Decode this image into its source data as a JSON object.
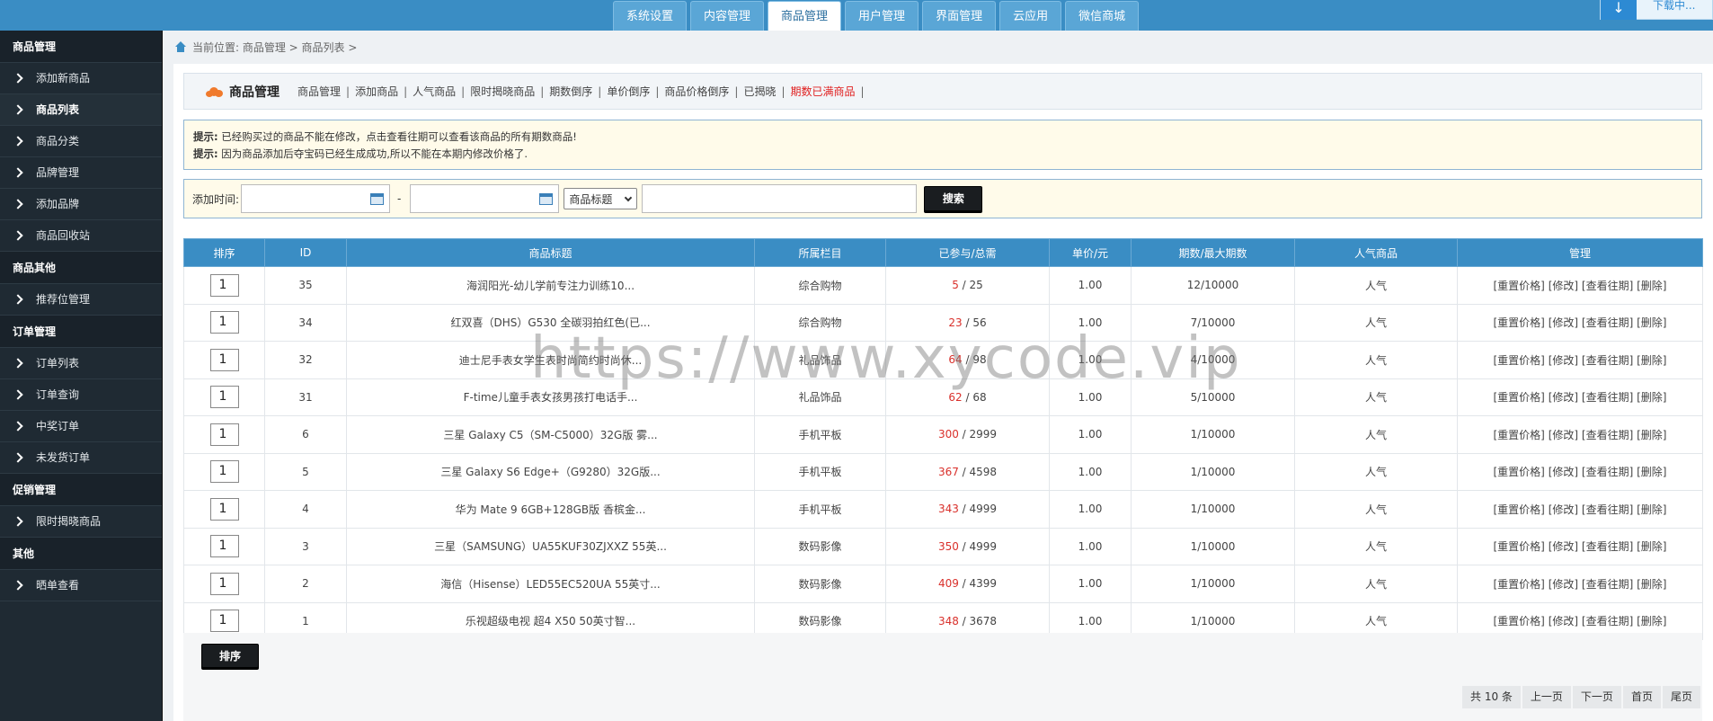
{
  "topnav": {
    "tabs": [
      {
        "label": "系统设置"
      },
      {
        "label": "内容管理"
      },
      {
        "label": "商品管理",
        "active": true
      },
      {
        "label": "用户管理"
      },
      {
        "label": "界面管理"
      },
      {
        "label": "云应用"
      },
      {
        "label": "微信商城"
      }
    ],
    "download_label": "下载中..."
  },
  "sidebar": {
    "sections": [
      {
        "title": "商品管理",
        "items": [
          {
            "label": "添加新商品"
          },
          {
            "label": "商品列表",
            "active": true
          },
          {
            "label": "商品分类"
          },
          {
            "label": "品牌管理"
          },
          {
            "label": "添加品牌"
          },
          {
            "label": "商品回收站"
          }
        ]
      },
      {
        "title": "商品其他",
        "items": [
          {
            "label": "推荐位管理"
          }
        ]
      },
      {
        "title": "订单管理",
        "items": [
          {
            "label": "订单列表"
          },
          {
            "label": "订单查询"
          },
          {
            "label": "中奖订单"
          },
          {
            "label": "未发货订单"
          }
        ]
      },
      {
        "title": "促销管理",
        "items": [
          {
            "label": "限时揭晓商品"
          }
        ]
      },
      {
        "title": "其他",
        "items": [
          {
            "label": "晒单查看"
          }
        ]
      }
    ]
  },
  "breadcrumb": {
    "text": "当前位置: 商品管理 > 商品列表 >"
  },
  "subnav": {
    "title": "商品管理",
    "links": [
      {
        "label": "商品管理"
      },
      {
        "label": "添加商品"
      },
      {
        "label": "人气商品"
      },
      {
        "label": "限时揭晓商品"
      },
      {
        "label": "期数倒序"
      },
      {
        "label": "单价倒序"
      },
      {
        "label": "商品价格倒序"
      },
      {
        "label": "已揭晓"
      },
      {
        "label": "期数已满商品",
        "highlight": true
      }
    ]
  },
  "tips": {
    "label": "提示:",
    "line1": "已经购买过的商品不能在修改，点击查看往期可以查看该商品的所有期数商品!",
    "line2": "因为商品添加后夺宝码已经生成成功,所以不能在本期内修改价格了."
  },
  "search": {
    "date_label": "添加时间:",
    "date_from": "",
    "date_to": "",
    "separator": "-",
    "field_select": "商品标题",
    "keyword": "",
    "button": "搜索"
  },
  "table": {
    "headers": [
      "排序",
      "ID",
      "商品标题",
      "所属栏目",
      "已参与/总需",
      "单价/元",
      "期数/最大期数",
      "人气商品",
      "管理"
    ],
    "rows": [
      {
        "sort": "1",
        "id": "35",
        "title": "海润阳光-幼儿学前专注力训练10...",
        "category": "综合购物",
        "joined": "5",
        "total": "25",
        "price": "1.00",
        "period": "12/10000",
        "hot": "人气"
      },
      {
        "sort": "1",
        "id": "34",
        "title": "红双喜（DHS）G530 全碳羽拍红色(已...",
        "category": "综合购物",
        "joined": "23",
        "total": "56",
        "price": "1.00",
        "period": "7/10000",
        "hot": "人气"
      },
      {
        "sort": "1",
        "id": "32",
        "title": "迪士尼手表女学生表时尚简约时尚休...",
        "category": "礼品饰品",
        "joined": "64",
        "total": "98",
        "price": "1.00",
        "period": "4/10000",
        "hot": "人气"
      },
      {
        "sort": "1",
        "id": "31",
        "title": "F-time儿童手表女孩男孩打电话手...",
        "category": "礼品饰品",
        "joined": "62",
        "total": "68",
        "price": "1.00",
        "period": "5/10000",
        "hot": "人气"
      },
      {
        "sort": "1",
        "id": "6",
        "title": "三星 Galaxy C5（SM-C5000）32G版 雾...",
        "category": "手机平板",
        "joined": "300",
        "total": "2999",
        "price": "1.00",
        "period": "1/10000",
        "hot": "人气"
      },
      {
        "sort": "1",
        "id": "5",
        "title": "三星 Galaxy S6 Edge+（G9280）32G版...",
        "category": "手机平板",
        "joined": "367",
        "total": "4598",
        "price": "1.00",
        "period": "1/10000",
        "hot": "人气"
      },
      {
        "sort": "1",
        "id": "4",
        "title": "华为 Mate 9 6GB+128GB版 香槟金...",
        "category": "手机平板",
        "joined": "343",
        "total": "4999",
        "price": "1.00",
        "period": "1/10000",
        "hot": "人气"
      },
      {
        "sort": "1",
        "id": "3",
        "title": "三星（SAMSUNG）UA55KUF30ZJXXZ 55英...",
        "category": "数码影像",
        "joined": "350",
        "total": "4999",
        "price": "1.00",
        "period": "1/10000",
        "hot": "人气"
      },
      {
        "sort": "1",
        "id": "2",
        "title": "海信（Hisense）LED55EC520UA 55英寸...",
        "category": "数码影像",
        "joined": "409",
        "total": "4399",
        "price": "1.00",
        "period": "1/10000",
        "hot": "人气"
      },
      {
        "sort": "1",
        "id": "1",
        "title": "乐视超级电视 超4 X50 50英寸智...",
        "category": "数码影像",
        "joined": "348",
        "total": "3678",
        "price": "1.00",
        "period": "1/10000",
        "hot": "人气"
      }
    ],
    "actions": [
      "[重置价格]",
      "[修改]",
      "[查看往期]",
      "[删除]"
    ]
  },
  "sort_button": "排序",
  "pager": {
    "total": "共 10 条",
    "prev": "上一页",
    "next": "下一页",
    "first": "首页",
    "last": "尾页"
  },
  "watermark": "https://www.xycode.vip",
  "colors": {
    "topbar": "#3a8dc4",
    "sidebar": "#1f2a33",
    "accent_red": "#d9302b",
    "notice_bg": "#fffbea"
  }
}
